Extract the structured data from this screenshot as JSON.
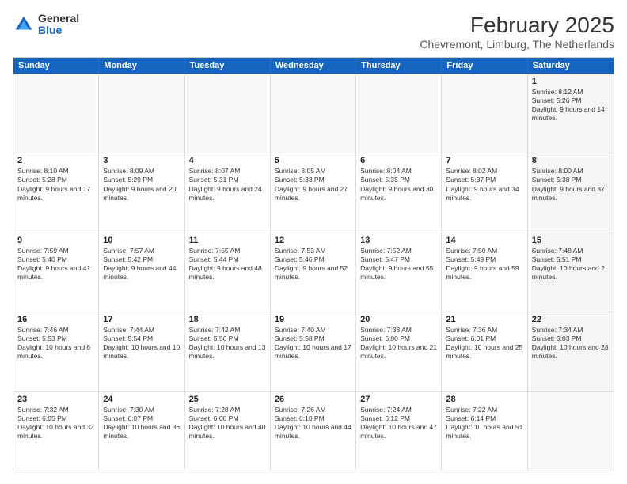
{
  "logo": {
    "general": "General",
    "blue": "Blue"
  },
  "title": "February 2025",
  "subtitle": "Chevremont, Limburg, The Netherlands",
  "days": [
    "Sunday",
    "Monday",
    "Tuesday",
    "Wednesday",
    "Thursday",
    "Friday",
    "Saturday"
  ],
  "rows": [
    [
      {
        "day": "",
        "text": "",
        "empty": true
      },
      {
        "day": "",
        "text": "",
        "empty": true
      },
      {
        "day": "",
        "text": "",
        "empty": true
      },
      {
        "day": "",
        "text": "",
        "empty": true
      },
      {
        "day": "",
        "text": "",
        "empty": true
      },
      {
        "day": "",
        "text": "",
        "empty": true
      },
      {
        "day": "1",
        "text": "Sunrise: 8:12 AM\nSunset: 5:26 PM\nDaylight: 9 hours and 14 minutes.",
        "shaded": true
      }
    ],
    [
      {
        "day": "2",
        "text": "Sunrise: 8:10 AM\nSunset: 5:28 PM\nDaylight: 9 hours and 17 minutes.",
        "shaded": false
      },
      {
        "day": "3",
        "text": "Sunrise: 8:09 AM\nSunset: 5:29 PM\nDaylight: 9 hours and 20 minutes.",
        "shaded": false
      },
      {
        "day": "4",
        "text": "Sunrise: 8:07 AM\nSunset: 5:31 PM\nDaylight: 9 hours and 24 minutes.",
        "shaded": false
      },
      {
        "day": "5",
        "text": "Sunrise: 8:05 AM\nSunset: 5:33 PM\nDaylight: 9 hours and 27 minutes.",
        "shaded": false
      },
      {
        "day": "6",
        "text": "Sunrise: 8:04 AM\nSunset: 5:35 PM\nDaylight: 9 hours and 30 minutes.",
        "shaded": false
      },
      {
        "day": "7",
        "text": "Sunrise: 8:02 AM\nSunset: 5:37 PM\nDaylight: 9 hours and 34 minutes.",
        "shaded": false
      },
      {
        "day": "8",
        "text": "Sunrise: 8:00 AM\nSunset: 5:38 PM\nDaylight: 9 hours and 37 minutes.",
        "shaded": true
      }
    ],
    [
      {
        "day": "9",
        "text": "Sunrise: 7:59 AM\nSunset: 5:40 PM\nDaylight: 9 hours and 41 minutes.",
        "shaded": false
      },
      {
        "day": "10",
        "text": "Sunrise: 7:57 AM\nSunset: 5:42 PM\nDaylight: 9 hours and 44 minutes.",
        "shaded": false
      },
      {
        "day": "11",
        "text": "Sunrise: 7:55 AM\nSunset: 5:44 PM\nDaylight: 9 hours and 48 minutes.",
        "shaded": false
      },
      {
        "day": "12",
        "text": "Sunrise: 7:53 AM\nSunset: 5:46 PM\nDaylight: 9 hours and 52 minutes.",
        "shaded": false
      },
      {
        "day": "13",
        "text": "Sunrise: 7:52 AM\nSunset: 5:47 PM\nDaylight: 9 hours and 55 minutes.",
        "shaded": false
      },
      {
        "day": "14",
        "text": "Sunrise: 7:50 AM\nSunset: 5:49 PM\nDaylight: 9 hours and 59 minutes.",
        "shaded": false
      },
      {
        "day": "15",
        "text": "Sunrise: 7:48 AM\nSunset: 5:51 PM\nDaylight: 10 hours and 2 minutes.",
        "shaded": true
      }
    ],
    [
      {
        "day": "16",
        "text": "Sunrise: 7:46 AM\nSunset: 5:53 PM\nDaylight: 10 hours and 6 minutes.",
        "shaded": false
      },
      {
        "day": "17",
        "text": "Sunrise: 7:44 AM\nSunset: 5:54 PM\nDaylight: 10 hours and 10 minutes.",
        "shaded": false
      },
      {
        "day": "18",
        "text": "Sunrise: 7:42 AM\nSunset: 5:56 PM\nDaylight: 10 hours and 13 minutes.",
        "shaded": false
      },
      {
        "day": "19",
        "text": "Sunrise: 7:40 AM\nSunset: 5:58 PM\nDaylight: 10 hours and 17 minutes.",
        "shaded": false
      },
      {
        "day": "20",
        "text": "Sunrise: 7:38 AM\nSunset: 6:00 PM\nDaylight: 10 hours and 21 minutes.",
        "shaded": false
      },
      {
        "day": "21",
        "text": "Sunrise: 7:36 AM\nSunset: 6:01 PM\nDaylight: 10 hours and 25 minutes.",
        "shaded": false
      },
      {
        "day": "22",
        "text": "Sunrise: 7:34 AM\nSunset: 6:03 PM\nDaylight: 10 hours and 28 minutes.",
        "shaded": true
      }
    ],
    [
      {
        "day": "23",
        "text": "Sunrise: 7:32 AM\nSunset: 6:05 PM\nDaylight: 10 hours and 32 minutes.",
        "shaded": false
      },
      {
        "day": "24",
        "text": "Sunrise: 7:30 AM\nSunset: 6:07 PM\nDaylight: 10 hours and 36 minutes.",
        "shaded": false
      },
      {
        "day": "25",
        "text": "Sunrise: 7:28 AM\nSunset: 6:08 PM\nDaylight: 10 hours and 40 minutes.",
        "shaded": false
      },
      {
        "day": "26",
        "text": "Sunrise: 7:26 AM\nSunset: 6:10 PM\nDaylight: 10 hours and 44 minutes.",
        "shaded": false
      },
      {
        "day": "27",
        "text": "Sunrise: 7:24 AM\nSunset: 6:12 PM\nDaylight: 10 hours and 47 minutes.",
        "shaded": false
      },
      {
        "day": "28",
        "text": "Sunrise: 7:22 AM\nSunset: 6:14 PM\nDaylight: 10 hours and 51 minutes.",
        "shaded": false
      },
      {
        "day": "",
        "text": "",
        "empty": true
      }
    ]
  ]
}
